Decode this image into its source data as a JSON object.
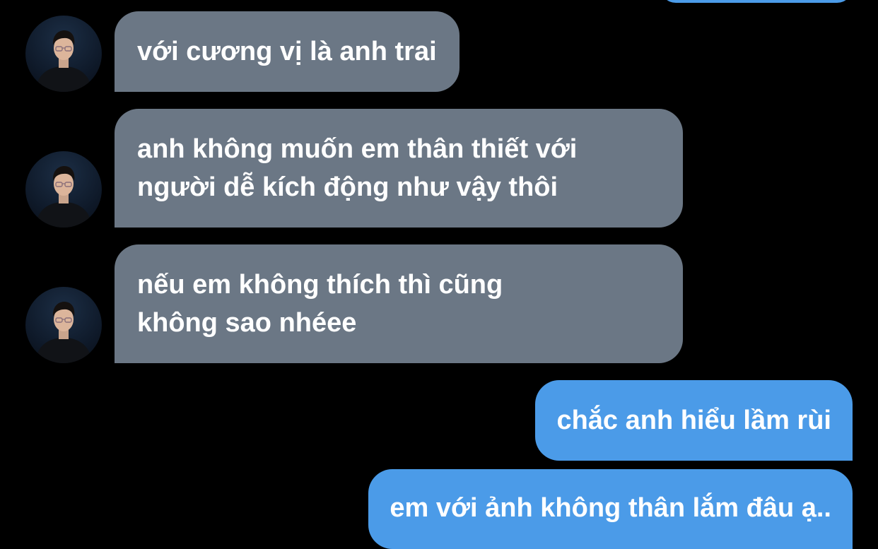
{
  "colors": {
    "background": "#000000",
    "incoming_bubble": "#6b7785",
    "outgoing_bubble": "#4b9be8",
    "text": "#ffffff"
  },
  "messages": [
    {
      "direction": "incoming",
      "lines": [
        "với cương vị là anh trai"
      ]
    },
    {
      "direction": "incoming",
      "lines": [
        "anh không muốn em thân thiết với",
        "người dễ kích động như vậy thôi"
      ]
    },
    {
      "direction": "incoming",
      "lines": [
        "nếu em không thích thì cũng",
        "không sao nhéee"
      ]
    },
    {
      "direction": "outgoing",
      "lines": [
        "chắc anh hiểu lầm rùi"
      ]
    },
    {
      "direction": "outgoing",
      "lines": [
        "em với ảnh không thân lắm đâu ạ.."
      ]
    }
  ]
}
